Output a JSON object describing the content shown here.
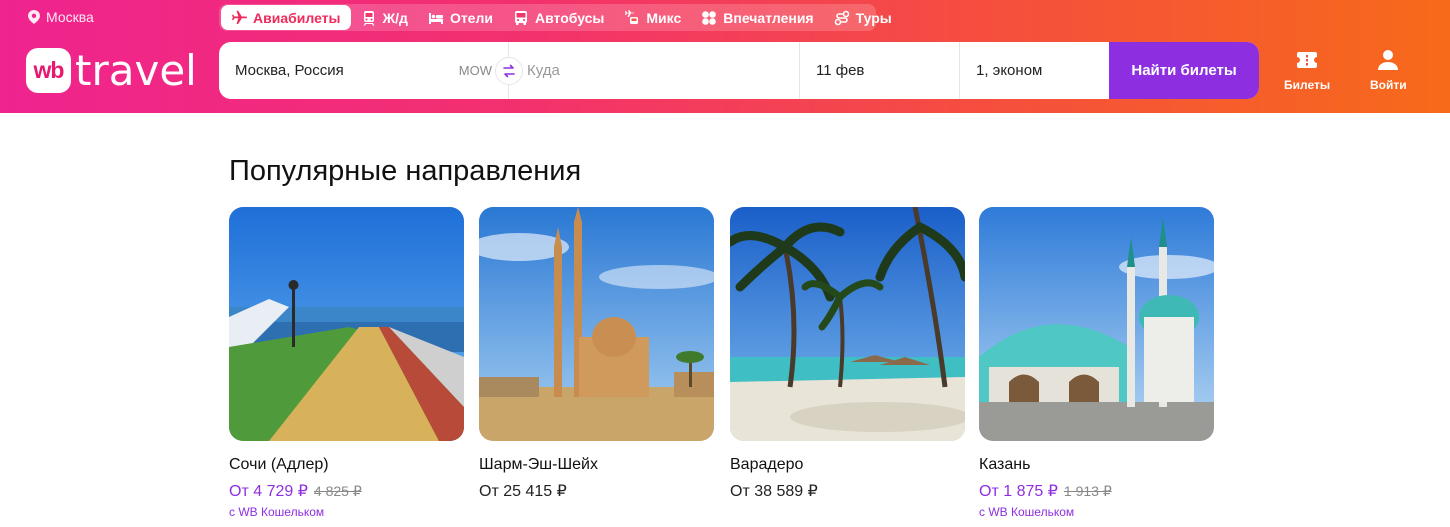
{
  "header": {
    "location": "Москва",
    "tabs": [
      {
        "label": "Авиабилеты",
        "icon": "plane-icon",
        "active": true
      },
      {
        "label": "Ж/д",
        "icon": "train-icon",
        "active": false
      },
      {
        "label": "Отели",
        "icon": "bed-icon",
        "active": false
      },
      {
        "label": "Автобусы",
        "icon": "bus-icon",
        "active": false
      },
      {
        "label": "Микс",
        "icon": "mix-icon",
        "active": false
      },
      {
        "label": "Впечатления",
        "icon": "flower-icon",
        "active": false
      },
      {
        "label": "Туры",
        "icon": "route-icon",
        "active": false
      }
    ],
    "logo": {
      "mark": "wb",
      "text": "travel"
    },
    "search": {
      "from": "Москва, Россия",
      "from_code": "MOW",
      "to_placeholder": "Куда",
      "date": "11 фев",
      "passengers": "1, эконом",
      "submit_label": "Найти билеты"
    },
    "actions": {
      "tickets_label": "Билеты",
      "login_label": "Войти"
    }
  },
  "popular": {
    "title": "Популярные направления",
    "cards": [
      {
        "name": "Сочи (Адлер)",
        "price": "От 4 729 ₽",
        "old_price": "4 825 ₽",
        "note": "с WB Кошельком",
        "discount": true
      },
      {
        "name": "Шарм-Эш-Шейх",
        "price": "От 25 415 ₽",
        "old_price": "",
        "note": "",
        "discount": false
      },
      {
        "name": "Варадеро",
        "price": "От 38 589 ₽",
        "old_price": "",
        "note": "",
        "discount": false
      },
      {
        "name": "Казань",
        "price": "От 1 875 ₽",
        "old_price": "1 913 ₽",
        "note": "с WB Кошельком",
        "discount": true
      }
    ]
  },
  "colors": {
    "accent_purple": "#8d2fe0",
    "header_gradient_start": "#f0238f",
    "header_gradient_end": "#f76a1a"
  }
}
